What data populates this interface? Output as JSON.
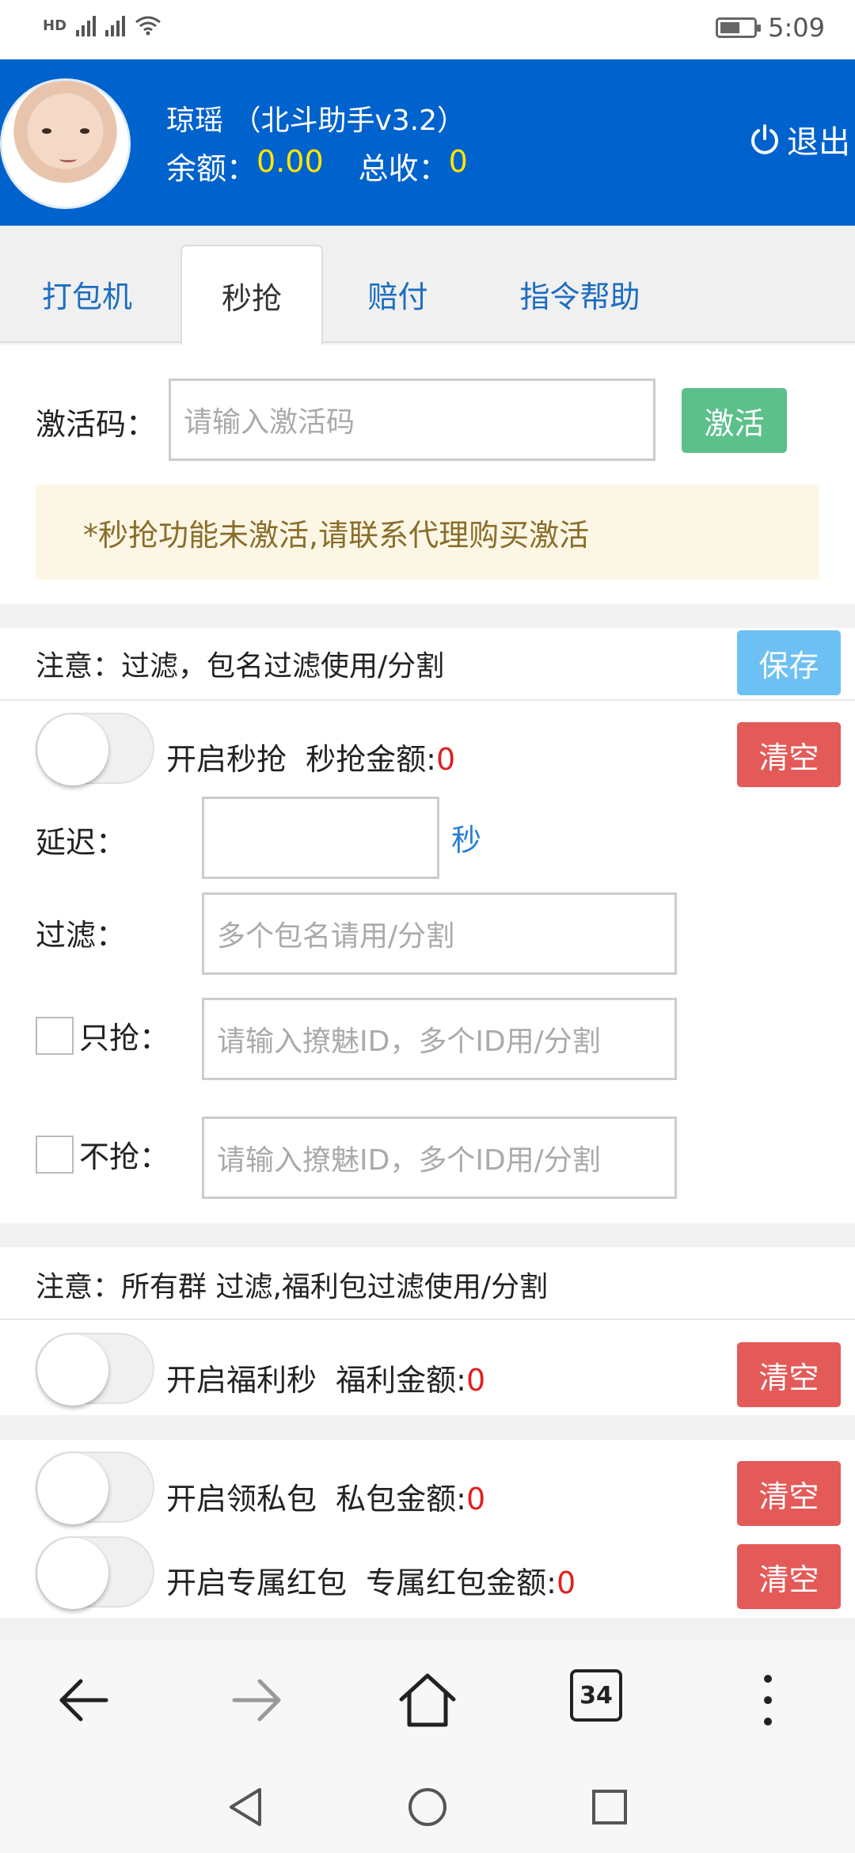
{
  "status_bar": {
    "left_text": "HD 4G 4G",
    "time": "5:09"
  },
  "header": {
    "title": "琼瑶 （北斗助手v3.2）",
    "balance_label": "余额：",
    "balance_value": "0.00",
    "total_label": "总收：",
    "total_value": "0",
    "logout_label": "退出"
  },
  "tabs": [
    {
      "label": "打包机"
    },
    {
      "label": "秒抢"
    },
    {
      "label": "赔付"
    },
    {
      "label": "指令帮助"
    }
  ],
  "activation": {
    "label": "激活码：",
    "placeholder": "请输入激活码",
    "button": "激活",
    "notice": "*秒抢功能未激活,请联系代理购买激活"
  },
  "section1": {
    "note": "注意：过滤，包名过滤使用/分割",
    "save_button": "保存",
    "toggle_label": "开启秒抢  秒抢金额:",
    "toggle_amount": "0",
    "clear_button": "清空",
    "delay_label": "延迟：",
    "delay_unit": "秒",
    "filter_label": "过滤：",
    "filter_placeholder": "多个包名请用/分割",
    "only_label": "只抢：",
    "only_placeholder": "请输入撩魅ID，多个ID用/分割",
    "not_label": "不抢：",
    "not_placeholder": "请输入撩魅ID，多个ID用/分割"
  },
  "section2": {
    "note": "注意：所有群 过滤,福利包过滤使用/分割",
    "toggle_label": "开启福利秒  福利金额:",
    "toggle_amount": "0",
    "clear_button": "清空"
  },
  "section3": {
    "private_label": "开启领私包  私包金额:",
    "private_amount": "0",
    "private_clear": "清空",
    "exclusive_label": "开启专属红包  专属红包金额:",
    "exclusive_amount": "0",
    "exclusive_clear": "清空"
  },
  "browser_nav": {
    "tab_count": "34"
  }
}
